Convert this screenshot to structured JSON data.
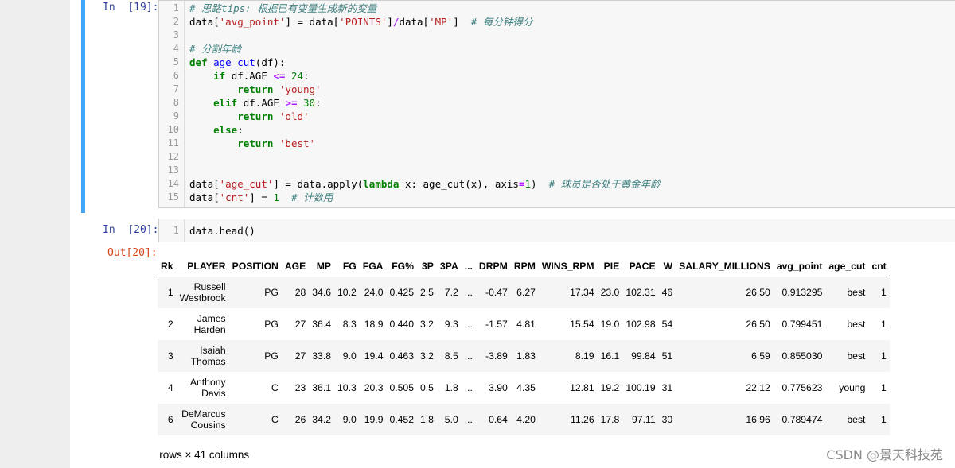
{
  "cell19": {
    "prompt": "In  [19]:",
    "lines": [
      {
        "num": "1",
        "tokens": [
          {
            "t": "# 思路tips: 根据已有变量生成新的变量",
            "c": "comment"
          }
        ]
      },
      {
        "num": "2",
        "tokens": [
          {
            "t": "data[",
            "c": "plain"
          },
          {
            "t": "'avg_point'",
            "c": "string"
          },
          {
            "t": "] = data[",
            "c": "plain"
          },
          {
            "t": "'POINTS'",
            "c": "string"
          },
          {
            "t": "]",
            "c": "plain"
          },
          {
            "t": "/",
            "c": "op"
          },
          {
            "t": "data[",
            "c": "plain"
          },
          {
            "t": "'MP'",
            "c": "string"
          },
          {
            "t": "]  ",
            "c": "plain"
          },
          {
            "t": "# 每分钟得分",
            "c": "comment"
          }
        ]
      },
      {
        "num": "3",
        "tokens": []
      },
      {
        "num": "4",
        "tokens": [
          {
            "t": "# 分割年龄",
            "c": "comment"
          }
        ]
      },
      {
        "num": "5",
        "tokens": [
          {
            "t": "def",
            "c": "keyword"
          },
          {
            "t": " ",
            "c": "plain"
          },
          {
            "t": "age_cut",
            "c": "func"
          },
          {
            "t": "(df):",
            "c": "plain"
          }
        ]
      },
      {
        "num": "6",
        "tokens": [
          {
            "t": "    ",
            "c": "plain"
          },
          {
            "t": "if",
            "c": "keyword"
          },
          {
            "t": " df.AGE ",
            "c": "plain"
          },
          {
            "t": "<=",
            "c": "op"
          },
          {
            "t": " ",
            "c": "plain"
          },
          {
            "t": "24",
            "c": "number"
          },
          {
            "t": ":",
            "c": "plain"
          }
        ]
      },
      {
        "num": "7",
        "tokens": [
          {
            "t": "        ",
            "c": "plain"
          },
          {
            "t": "return",
            "c": "keyword"
          },
          {
            "t": " ",
            "c": "plain"
          },
          {
            "t": "'young'",
            "c": "string"
          }
        ]
      },
      {
        "num": "8",
        "tokens": [
          {
            "t": "    ",
            "c": "plain"
          },
          {
            "t": "elif",
            "c": "keyword"
          },
          {
            "t": " df.AGE ",
            "c": "plain"
          },
          {
            "t": ">=",
            "c": "op"
          },
          {
            "t": " ",
            "c": "plain"
          },
          {
            "t": "30",
            "c": "number"
          },
          {
            "t": ":",
            "c": "plain"
          }
        ]
      },
      {
        "num": "9",
        "tokens": [
          {
            "t": "        ",
            "c": "plain"
          },
          {
            "t": "return",
            "c": "keyword"
          },
          {
            "t": " ",
            "c": "plain"
          },
          {
            "t": "'old'",
            "c": "string"
          }
        ]
      },
      {
        "num": "10",
        "tokens": [
          {
            "t": "    ",
            "c": "plain"
          },
          {
            "t": "else",
            "c": "keyword"
          },
          {
            "t": ":",
            "c": "plain"
          }
        ]
      },
      {
        "num": "11",
        "tokens": [
          {
            "t": "        ",
            "c": "plain"
          },
          {
            "t": "return",
            "c": "keyword"
          },
          {
            "t": " ",
            "c": "plain"
          },
          {
            "t": "'best'",
            "c": "string"
          }
        ]
      },
      {
        "num": "12",
        "tokens": []
      },
      {
        "num": "13",
        "tokens": []
      },
      {
        "num": "14",
        "tokens": [
          {
            "t": "data[",
            "c": "plain"
          },
          {
            "t": "'age_cut'",
            "c": "string"
          },
          {
            "t": "] = data.apply(",
            "c": "plain"
          },
          {
            "t": "lambda",
            "c": "keyword"
          },
          {
            "t": " x: age_cut(x), axis",
            "c": "plain"
          },
          {
            "t": "=",
            "c": "op"
          },
          {
            "t": "1",
            "c": "number"
          },
          {
            "t": ")  ",
            "c": "plain"
          },
          {
            "t": "# 球员是否处于黄金年龄",
            "c": "comment"
          }
        ]
      },
      {
        "num": "15",
        "tokens": [
          {
            "t": "data[",
            "c": "plain"
          },
          {
            "t": "'cnt'",
            "c": "string"
          },
          {
            "t": "] = ",
            "c": "plain"
          },
          {
            "t": "1",
            "c": "number"
          },
          {
            "t": "  ",
            "c": "plain"
          },
          {
            "t": "# 计数用",
            "c": "comment"
          }
        ]
      }
    ]
  },
  "cell20": {
    "in_prompt": "In  [20]:",
    "out_prompt": "Out[20]:",
    "lines": [
      {
        "num": "1",
        "tokens": [
          {
            "t": "data.head()",
            "c": "plain"
          }
        ]
      }
    ]
  },
  "dataframe": {
    "columns": [
      "Rk",
      "PLAYER",
      "POSITION",
      "AGE",
      "MP",
      "FG",
      "FGA",
      "FG%",
      "3P",
      "3PA",
      "...",
      "DRPM",
      "RPM",
      "WINS_RPM",
      "PIE",
      "PACE",
      "W",
      "SALARY_MILLIONS",
      "avg_point",
      "age_cut",
      "cnt"
    ],
    "rows": [
      [
        "1",
        "Russell Westbrook",
        "PG",
        "28",
        "34.6",
        "10.2",
        "24.0",
        "0.425",
        "2.5",
        "7.2",
        "...",
        "-0.47",
        "6.27",
        "17.34",
        "23.0",
        "102.31",
        "46",
        "26.50",
        "0.913295",
        "best",
        "1"
      ],
      [
        "2",
        "James Harden",
        "PG",
        "27",
        "36.4",
        "8.3",
        "18.9",
        "0.440",
        "3.2",
        "9.3",
        "...",
        "-1.57",
        "4.81",
        "15.54",
        "19.0",
        "102.98",
        "54",
        "26.50",
        "0.799451",
        "best",
        "1"
      ],
      [
        "3",
        "Isaiah Thomas",
        "PG",
        "27",
        "33.8",
        "9.0",
        "19.4",
        "0.463",
        "3.2",
        "8.5",
        "...",
        "-3.89",
        "1.83",
        "8.19",
        "16.1",
        "99.84",
        "51",
        "6.59",
        "0.855030",
        "best",
        "1"
      ],
      [
        "4",
        "Anthony Davis",
        "C",
        "23",
        "36.1",
        "10.3",
        "20.3",
        "0.505",
        "0.5",
        "1.8",
        "...",
        "3.90",
        "4.35",
        "12.81",
        "19.2",
        "100.19",
        "31",
        "22.12",
        "0.775623",
        "young",
        "1"
      ],
      [
        "6",
        "DeMarcus Cousins",
        "C",
        "26",
        "34.2",
        "9.0",
        "19.9",
        "0.452",
        "1.8",
        "5.0",
        "...",
        "0.64",
        "4.20",
        "11.26",
        "17.8",
        "97.11",
        "30",
        "16.96",
        "0.789474",
        "best",
        "1"
      ]
    ],
    "footer": "5 rows × 41 columns"
  },
  "watermark": "CSDN @景天科技苑",
  "colors": {
    "selected_cell_bar": "#42a5f5",
    "in_prompt": "#303f9f",
    "out_prompt": "#d84315",
    "comment": "#408080",
    "string": "#ba2121",
    "keyword": "#008000"
  }
}
